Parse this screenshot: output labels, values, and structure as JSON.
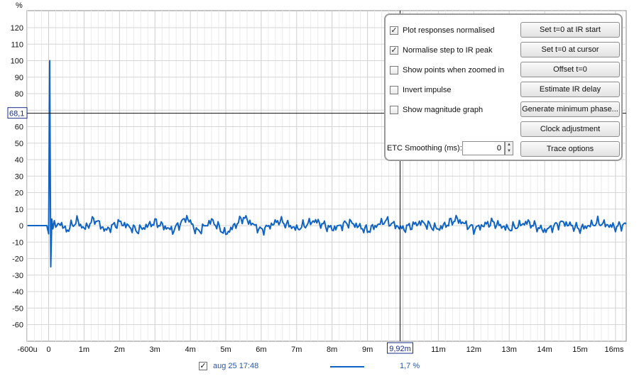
{
  "plot": {
    "y_unit": "%",
    "y_ticks": [
      "120",
      "110",
      "100",
      "90",
      "80",
      "70",
      "60",
      "50",
      "40",
      "30",
      "20",
      "10",
      "0",
      "-10",
      "-20",
      "-30",
      "-40",
      "-50",
      "-60"
    ],
    "x_ticks": [
      "-600u",
      "0",
      "1m",
      "2m",
      "3m",
      "4m",
      "5m",
      "6m",
      "7m",
      "8m",
      "9m",
      "10m",
      "11m",
      "12m",
      "13m",
      "14m",
      "15m",
      "16ms"
    ],
    "x_tick_values_ms": [
      -0.6,
      0,
      1,
      2,
      3,
      4,
      5,
      6,
      7,
      8,
      9,
      10,
      11,
      12,
      13,
      14,
      15,
      16
    ],
    "y_tick_values": [
      120,
      110,
      100,
      90,
      80,
      70,
      60,
      50,
      40,
      30,
      20,
      10,
      0,
      -10,
      -20,
      -30,
      -40,
      -50,
      -60
    ],
    "cursor_y_label": "68,1",
    "cursor_y_value": 68.1,
    "cursor_x_label": "9,92m",
    "cursor_x_value_ms": 9.92,
    "trace_color": "#0f63c4",
    "grid_color": "#d6d6d6"
  },
  "chart_data": {
    "type": "line",
    "title": "",
    "xlabel": "",
    "ylabel": "%",
    "xlim_ms": [
      -0.6,
      16.3
    ],
    "ylim": [
      -65,
      127
    ],
    "series": [
      {
        "x_ms": [
          -0.6,
          -0.05,
          0.0,
          0.03,
          0.06,
          0.09,
          0.12,
          0.16,
          0.2,
          0.3,
          0.5,
          0.8,
          1.0,
          1.3,
          1.6,
          2.0,
          2.5,
          3.0,
          3.5,
          3.9,
          4.2,
          4.6,
          5.0,
          5.5,
          6.0,
          6.5,
          7.0,
          7.5,
          8.0,
          8.5,
          9.0,
          9.5,
          10.0,
          10.5,
          11.0,
          11.5,
          12.0,
          12.5,
          13.0,
          13.5,
          14.0,
          14.5,
          15.0,
          15.5,
          16.0,
          16.3
        ],
        "values": [
          0,
          0,
          -5,
          100,
          -25,
          4,
          -2,
          3,
          -1,
          2,
          -3,
          3,
          -2,
          4,
          -3,
          2,
          -3,
          2,
          -3,
          5,
          -4,
          3,
          -5,
          5,
          -3,
          3,
          -2,
          3,
          -2,
          2,
          -3,
          3,
          -2,
          2,
          -2,
          4,
          -2,
          2,
          -2,
          2,
          -3,
          2,
          -2,
          2,
          -1,
          1
        ]
      }
    ]
  },
  "panel": {
    "options": [
      {
        "label": "Plot responses normalised",
        "checked": true,
        "mark": "✓"
      },
      {
        "label": "Normalise step to IR peak",
        "checked": true,
        "mark": "✓"
      },
      {
        "label": "Show points when zoomed in",
        "checked": false,
        "mark": ""
      },
      {
        "label": "Invert impulse",
        "checked": false,
        "mark": ""
      },
      {
        "label": "Show magnitude graph",
        "checked": false,
        "mark": ""
      }
    ],
    "buttons": [
      "Set t=0 at IR start",
      "Set t=0 at cursor",
      "Offset t=0",
      "Estimate IR delay",
      "Generate minimum phase...",
      "Clock adjustment",
      "Trace options"
    ],
    "smoothing_label": "ETC Smoothing (ms):",
    "smoothing_value": "0"
  },
  "legend": {
    "checkbox_mark": "✓",
    "name": "aug 25 17:48",
    "value": "1,7 %",
    "color": "#0f63c4"
  }
}
